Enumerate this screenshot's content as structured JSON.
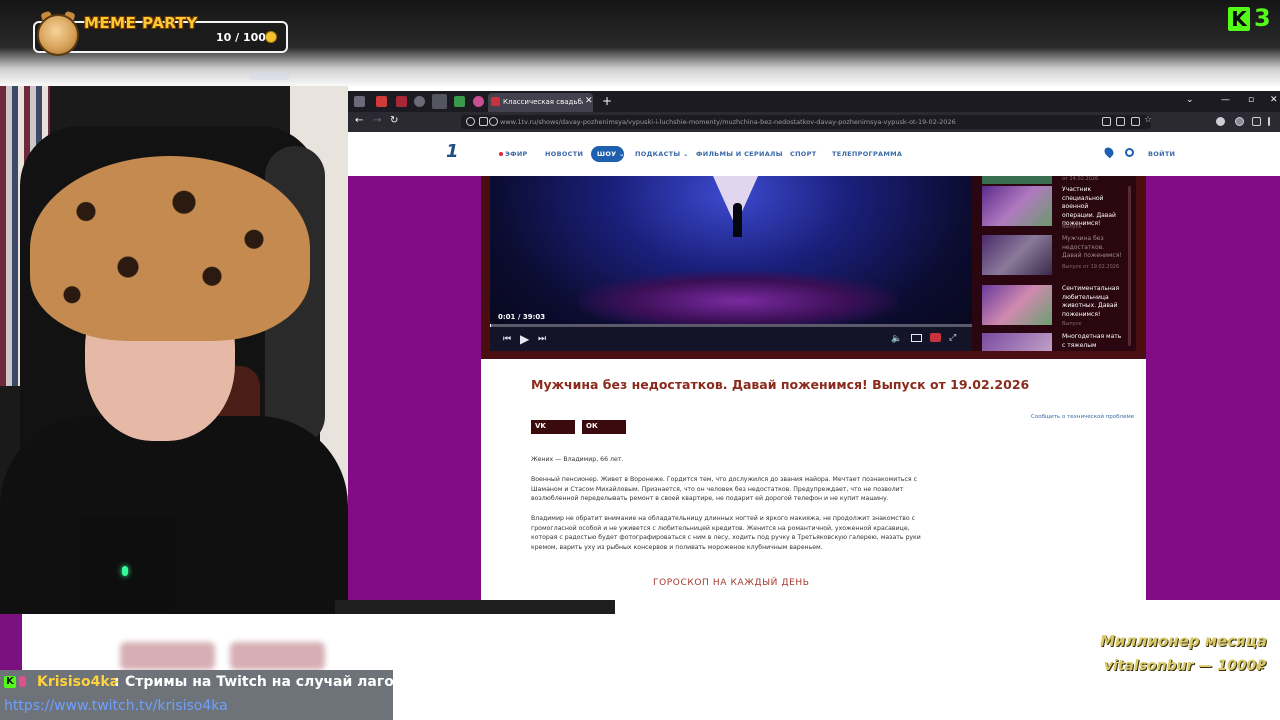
{
  "overlay": {
    "meme_widget": {
      "title": "MEME PARTY",
      "counter": "10 / 100"
    },
    "kick_badge": {
      "letter": "K",
      "number": "3"
    },
    "chat": {
      "username": "Krisiso4ka",
      "separator": ":",
      "message": "Стримы на Twitch на случай лагов",
      "link": "https://www.twitch.tv/krisiso4ka"
    },
    "millionaire": {
      "label": "Миллионер месяца",
      "donor": "vitalsonbur — 1000₽"
    }
  },
  "browser": {
    "tab": {
      "title": "Классическая свадьба VS Сва",
      "close": "✕",
      "new": "+"
    },
    "window_controls": {
      "menu": "⌄",
      "minimize": "—",
      "maximize": "▫",
      "close": "✕"
    },
    "nav": {
      "back": "←",
      "forward": "→",
      "reload": "↻"
    },
    "url": "www.1tv.ru/shows/davay-pozhenimsya/vypuski-i-luchshie-momenty/muzhchina-bez-nedostatkov-davay-pozhenimsya-vypusk-ot-19-02-2026"
  },
  "site": {
    "logo": "1",
    "nav": {
      "efir": "ЭФИР",
      "news": "НОВОСТИ",
      "shows": "ШОУ ⌄",
      "podcasts": "ПОДКАСТЫ ⌄",
      "films": "ФИЛЬМЫ И СЕРИАЛЫ",
      "sport": "СПОРТ",
      "tv": "ТЕЛЕПРОГРАММА",
      "login": "ВОЙТИ"
    },
    "player": {
      "time": "0:01 / 39:03",
      "progress_fraction": 0.0004
    },
    "sidebar": {
      "date_top": "от 24.02.2026",
      "items": [
        {
          "title": "Участник специальной военной операции. Давай поженимся!",
          "sub": "Выпуск"
        },
        {
          "title": "Мужчина без недостатков. Давай поженимся!",
          "sub": "Выпуск от 19.02.2026"
        },
        {
          "title": "Сентиментальная любительница животных. Давай поженимся!",
          "sub": "Выпуск"
        },
        {
          "title": "Многодетная мать с тяжелым",
          "sub": ""
        }
      ]
    },
    "article": {
      "title": "Мужчина без недостатков. Давай поженимся! Выпуск от 19.02.2026",
      "report_link": "Сообщить о технической проблеме",
      "share_vk": "VK",
      "share_ok": "ОК",
      "p1": "Жених — Владимир, 66 лет.",
      "p2": "Военный пенсионер. Живет в Воронеже. Гордится тем, что дослужился до звания майора. Мечтает познакомиться с Шаманом и Стасом Михайловым. Признается, что он человек без недостатков. Предупреждает, что не позволит возлюбленной переделывать ремонт в своей квартире, не подарит ей дорогой телефон и не купит машину.",
      "p3": "Владимир не обратит внимание на обладательницу длинных ногтей и яркого макияжа, не продолжит знакомство с громогласной особой и не уживется с любительницей кредитов. Женится на романтичной, ухоженной красавице, которая с радостью будет фотографироваться с ним в лесу, ходить под ручку в Третьяковскую галерею, мазать руки кремом, варить уху из рыбных консервов и поливать мороженое клубничным вареньем.",
      "horoscope": "ГОРОСКОП НА КАЖДЫЙ ДЕНЬ"
    }
  },
  "colors": {
    "site_purple": "#820c86",
    "title_red": "#8a2b1d",
    "kick_green": "#53fc18",
    "chat_user": "#ffd23c"
  }
}
